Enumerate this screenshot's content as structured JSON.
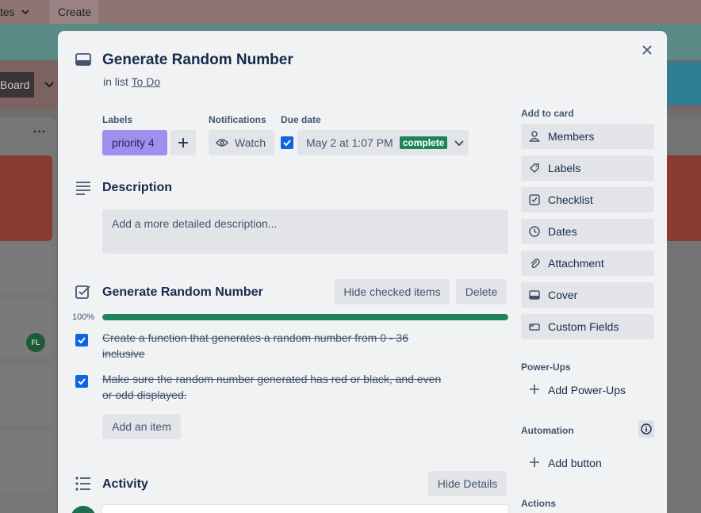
{
  "background": {
    "menu_label": "tes",
    "create_label": "Create",
    "board_label": "Board",
    "list_menu": "···",
    "avatar_initials": "FL"
  },
  "card": {
    "title": "Generate Random Number",
    "in_list_prefix": "in list",
    "list_name": "To Do"
  },
  "meta": {
    "labels_heading": "Labels",
    "label_value": "priority 4",
    "label_color": "#9f8fef",
    "notifications_heading": "Notifications",
    "watch_label": "Watch",
    "due_heading": "Due date",
    "due_value": "May 2 at 1:07 PM",
    "due_badge": "complete",
    "due_checked": true
  },
  "description": {
    "heading": "Description",
    "placeholder": "Add a more detailed description..."
  },
  "checklist": {
    "title": "Generate Random Number",
    "hide_checked_label": "Hide checked items",
    "delete_label": "Delete",
    "progress_label": "100%",
    "progress": 1.0,
    "items": [
      {
        "text": "Create a function that generates a random number from 0 - 36 inclusive",
        "checked": true
      },
      {
        "text": "Make sure the random number generated has red or black, and even or odd displayed.",
        "checked": true
      }
    ],
    "add_item_label": "Add an item"
  },
  "activity": {
    "heading": "Activity",
    "hide_details_label": "Hide Details"
  },
  "sidebar": {
    "add_to_card_heading": "Add to card",
    "add_items": [
      {
        "label": "Members",
        "icon": "person-icon"
      },
      {
        "label": "Labels",
        "icon": "tag-icon"
      },
      {
        "label": "Checklist",
        "icon": "checklist-icon"
      },
      {
        "label": "Dates",
        "icon": "clock-icon"
      },
      {
        "label": "Attachment",
        "icon": "paperclip-icon"
      },
      {
        "label": "Cover",
        "icon": "cover-icon"
      },
      {
        "label": "Custom Fields",
        "icon": "custom-fields-icon"
      }
    ],
    "powerups_heading": "Power-Ups",
    "add_powerups_label": "Add Power-Ups",
    "automation_heading": "Automation",
    "add_button_label": "Add button",
    "actions_heading": "Actions"
  },
  "colors": {
    "accent_blue": "#0c66e4",
    "success_green": "#1f845a"
  }
}
